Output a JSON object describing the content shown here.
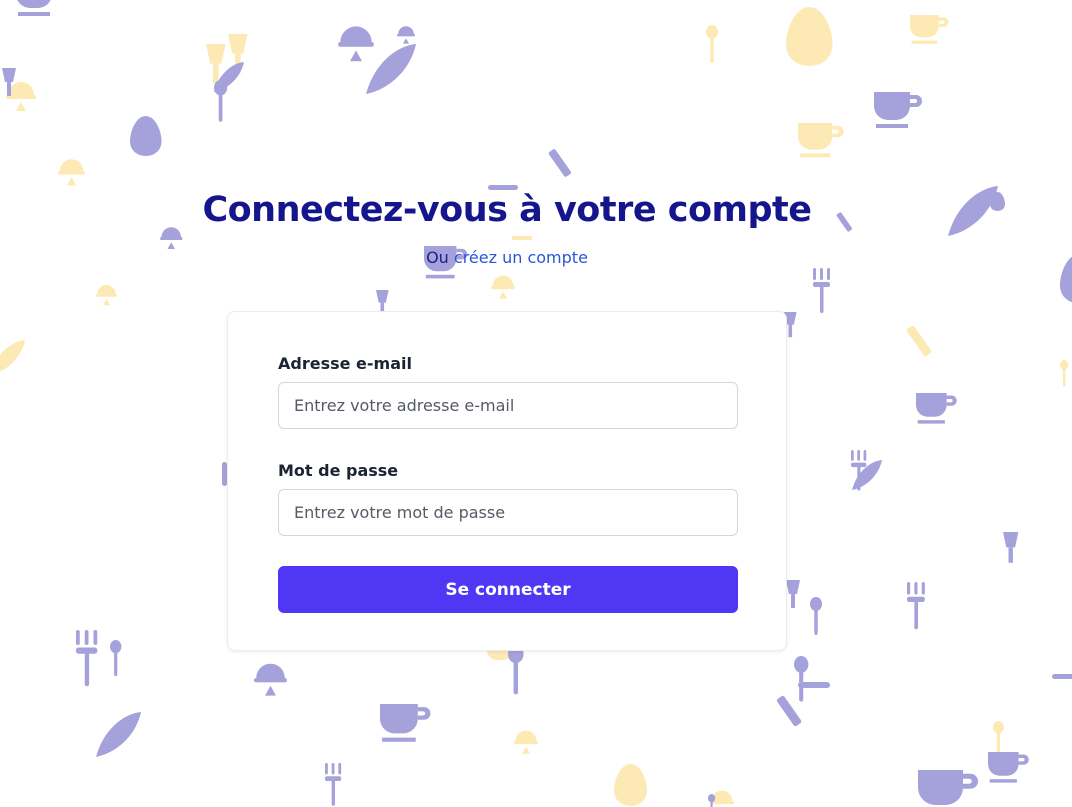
{
  "title": "Connectez-vous à votre compte",
  "subtitle": {
    "prefix": "Ou",
    "link": "créez un compte"
  },
  "form": {
    "email_label": "Adresse e-mail",
    "email_placeholder": "Entrez votre adresse e-mail",
    "password_label": "Mot de passe",
    "password_placeholder": "Entrez votre mot de passe",
    "submit_label": "Se connecter"
  },
  "colors": {
    "title": "#16168c",
    "link": "#2a55d6",
    "button": "#4f37f4",
    "pattern_purple": "#a5a1da",
    "pattern_yellow": "#fde9b4"
  },
  "background_icons": [
    "cup-icon",
    "egg-icon",
    "fork-icon",
    "spoon-icon",
    "bell-icon",
    "leaf-icon",
    "glass-icon",
    "knife-icon"
  ]
}
